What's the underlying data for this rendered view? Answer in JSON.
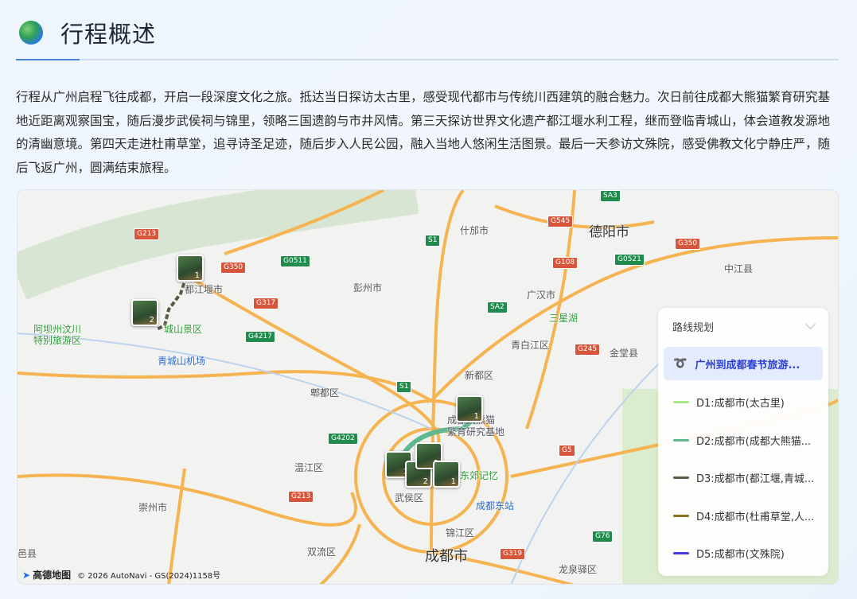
{
  "header": {
    "title": "行程概述",
    "icon": "globe-icon"
  },
  "summary": "行程从广州启程飞往成都，开启一段深度文化之旅。抵达当日探访太古里，感受现代都市与传统川西建筑的融合魅力。次日前往成都大熊猫繁育研究基地近距离观察国宝，随后漫步武侯祠与锦里，领略三国遗韵与市井风情。第三天探访世界文化遗产都江堰水利工程，继而登临青城山，体会道教发源地的清幽意境。第四天走进杜甫草堂，追寻诗圣足迹，随后步入人民公园，融入当地人悠闲生活图景。最后一天参访文殊院，感受佛教文化宁静庄严，随后飞返广州，圆满结束旅程。",
  "map": {
    "labels": [
      "德阳市",
      "什邡市",
      "彭州市",
      "广汉市",
      "都江堰市",
      "新都区",
      "郫都区",
      "成都市",
      "温江区",
      "崇州市",
      "双流区",
      "龙泉驿区",
      "锦江区",
      "武侯区",
      "青白江区",
      "金堂县",
      "中江县",
      "三星湖",
      "东郊记忆",
      "成都东站",
      "青城山机场",
      "阿坝州汶川\n特别旅游区",
      "城山景区",
      "成都大熊猫\n繁育研究基地",
      "邑县"
    ],
    "shields": [
      "G213",
      "G350",
      "G0511",
      "S1",
      "G545",
      "G108",
      "SA3",
      "G0521",
      "G317",
      "G4217",
      "SA2",
      "G245",
      "G4202",
      "G5",
      "G76",
      "G319",
      "S1",
      "G350",
      "G213"
    ],
    "markers": [
      "1",
      "2",
      "1",
      "1",
      "2",
      "3",
      "1"
    ],
    "attribution": {
      "logo": "高德地图",
      "text": "© 2026 AutoNavi - GS(2024)1158号"
    }
  },
  "route_panel": {
    "title": "路线规划",
    "selected": "广州到成都春节旅游...",
    "days": [
      {
        "label": "D1:成都市(太古里)",
        "color": "#a8e88f"
      },
      {
        "label": "D2:成都市(成都大熊猫...",
        "color": "#5fb88e"
      },
      {
        "label": "D3:成都市(都江堰,青城...",
        "color": "#5a5a44"
      },
      {
        "label": "D4:成都市(杜甫草堂,人...",
        "color": "#8a7020"
      },
      {
        "label": "D5:成都市(文殊院)",
        "color": "#4a3ad6"
      }
    ]
  },
  "colors": {
    "accent": "#2c3fd6",
    "road": "#f5b451"
  }
}
